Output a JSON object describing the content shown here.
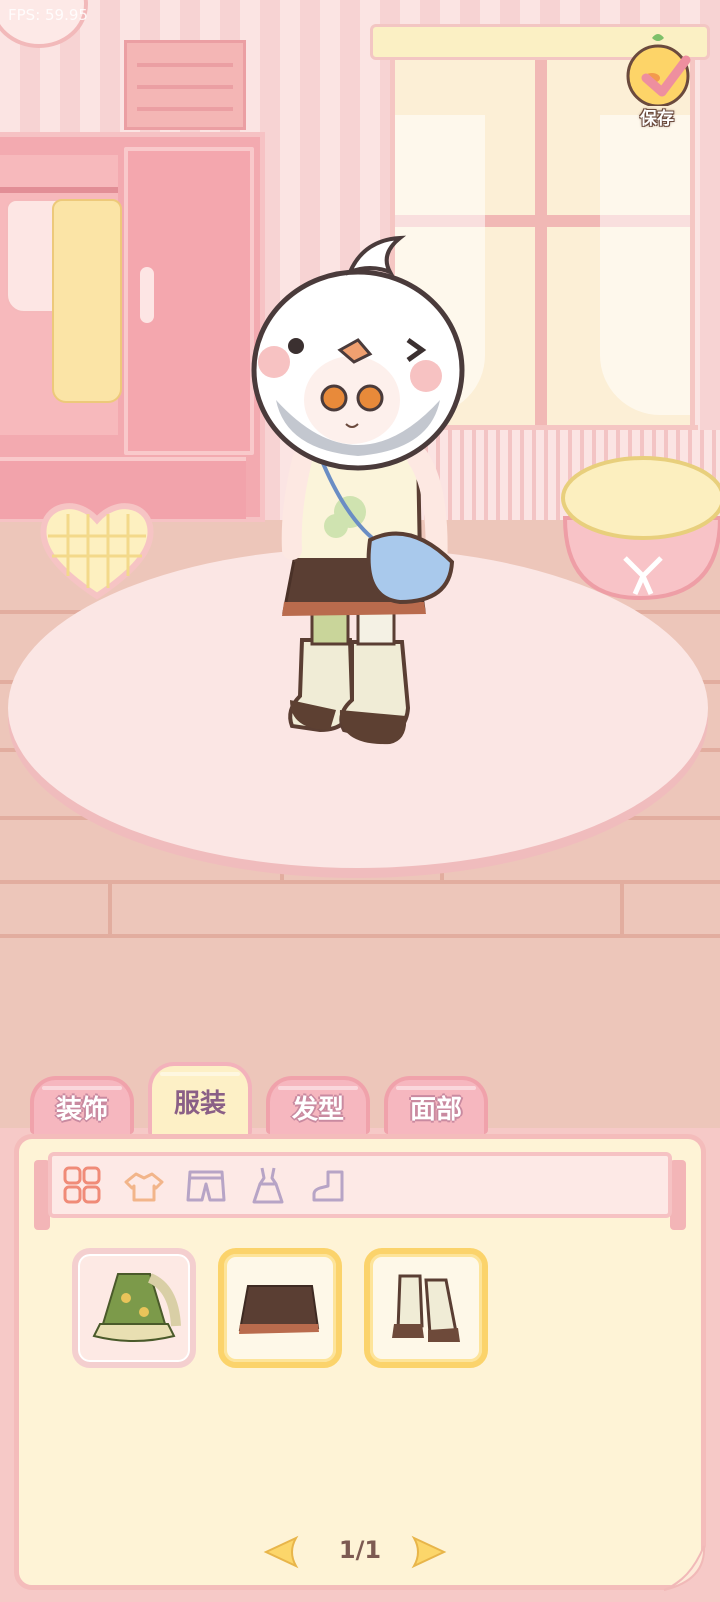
{
  "hud": {
    "fps_text": "FPS: 59.95"
  },
  "save_button": {
    "label": "保存"
  },
  "tabs": [
    {
      "id": "decor",
      "label": "装饰",
      "active": false
    },
    {
      "id": "clothing",
      "label": "服装",
      "active": true
    },
    {
      "id": "hair",
      "label": "发型",
      "active": false
    },
    {
      "id": "face",
      "label": "面部",
      "active": false
    }
  ],
  "categories": [
    {
      "id": "all",
      "icon": "grid-icon",
      "active": true
    },
    {
      "id": "top",
      "icon": "shirt-icon",
      "active": false
    },
    {
      "id": "bottom",
      "icon": "shorts-icon",
      "active": false
    },
    {
      "id": "dress",
      "icon": "dress-icon",
      "active": false
    },
    {
      "id": "shoes",
      "icon": "boot-icon",
      "active": false
    }
  ],
  "items": [
    {
      "id": "green-dress-outfit",
      "icon": "green-dress-icon",
      "selected": false
    },
    {
      "id": "brown-shorts",
      "icon": "brown-shorts-icon",
      "selected": true
    },
    {
      "id": "cream-boots",
      "icon": "cream-boots-icon",
      "selected": true
    }
  ],
  "pagination": {
    "label": "1/1",
    "current": 1,
    "total": 1
  },
  "colors": {
    "tab_inactive": "#f6b7bf",
    "tab_active": "#fdf0c6",
    "selected_border": "#fbd36b",
    "panel_bg": "#fef3d6"
  }
}
